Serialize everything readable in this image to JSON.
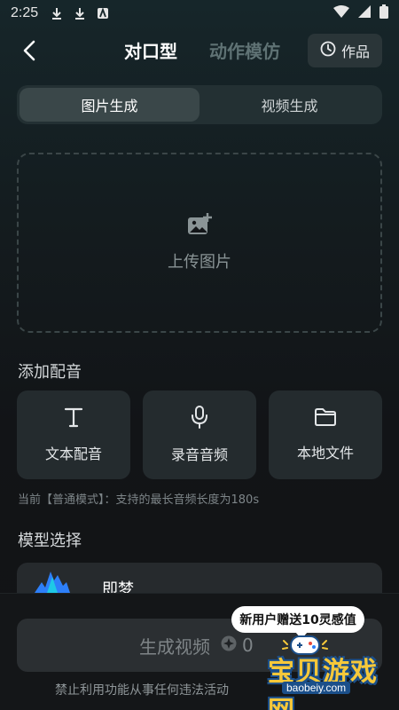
{
  "status_bar": {
    "time": "2:25"
  },
  "header": {
    "tab_active": "对口型",
    "tab_inactive": "动作模仿",
    "works_label": "作品"
  },
  "segment": {
    "options": [
      "图片生成",
      "视频生成"
    ],
    "selected": "图片生成"
  },
  "upload": {
    "label": "上传图片"
  },
  "audio": {
    "section_title": "添加配音",
    "options": [
      {
        "label": "文本配音",
        "icon": "text-icon"
      },
      {
        "label": "录音音频",
        "icon": "microphone-icon"
      },
      {
        "label": "本地文件",
        "icon": "folder-icon"
      }
    ],
    "hint": "当前【普通模式】：支持的最长音频长度为180s"
  },
  "model": {
    "section_title": "模型选择",
    "name": "即梦"
  },
  "generate": {
    "label": "生成视频",
    "cost": "0"
  },
  "footer": {
    "note": "禁止利用功能从事任何违法活动"
  },
  "promo": {
    "bubble": "新用户赠送10灵感值"
  },
  "watermark": {
    "text": "宝贝游戏网",
    "url": "baobeiy.com"
  },
  "colors": {
    "accent": "#ffffff",
    "inactive_tab": "#5f7274",
    "card": "#242b2e"
  }
}
